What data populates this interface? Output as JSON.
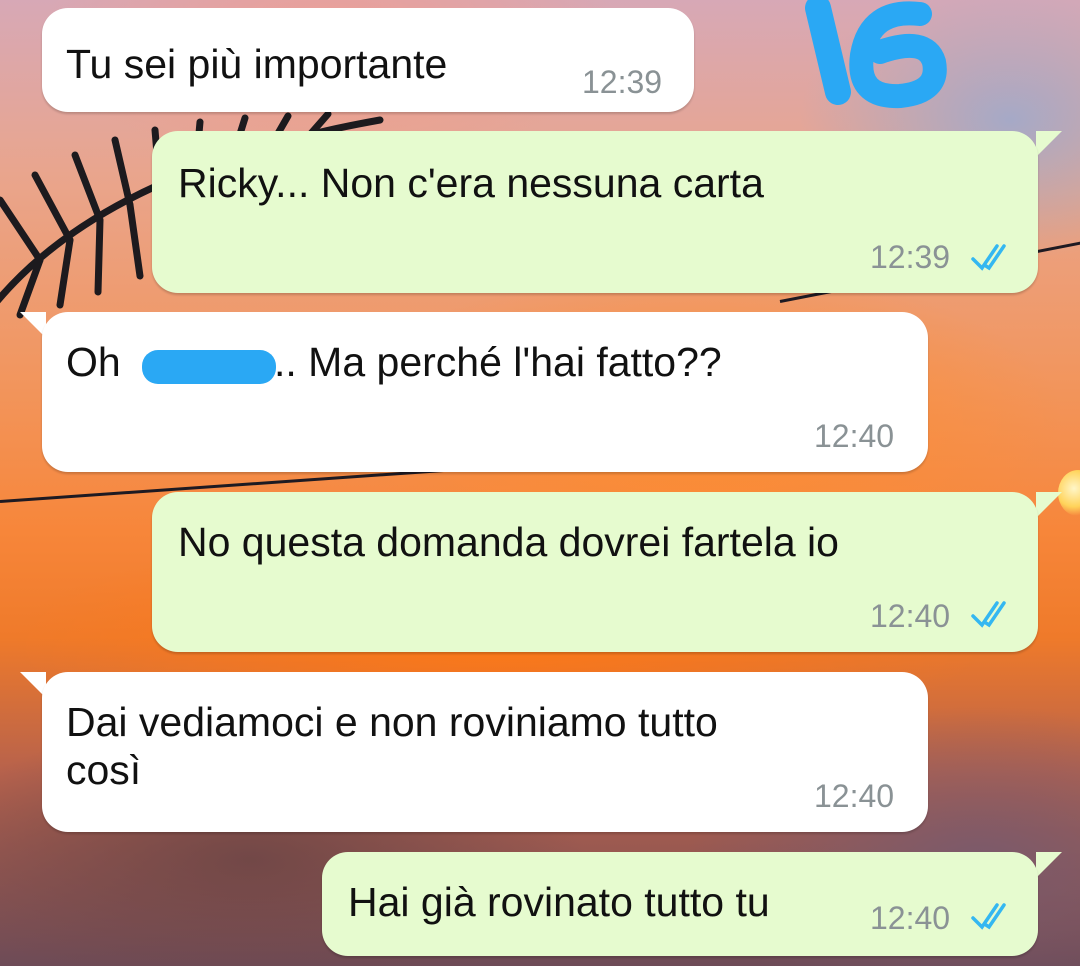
{
  "chat": {
    "messages": [
      {
        "direction": "incoming",
        "text": "Tu sei più importante",
        "time": "12:39"
      },
      {
        "direction": "outgoing",
        "text": "Ricky... Non c'era nessuna carta",
        "time": "12:39",
        "status": "read-double-check"
      },
      {
        "direction": "incoming",
        "text_prefix": "Oh",
        "text_suffix": ".. Ma perché l'hai fatto??",
        "redacted": true,
        "time": "12:40"
      },
      {
        "direction": "outgoing",
        "text": "No questa domanda dovrei fartela io",
        "time": "12:40",
        "status": "read-double-check"
      },
      {
        "direction": "incoming",
        "text": "Dai vediamoci e non roviniamo tutto\ncosì",
        "time": "12:40"
      },
      {
        "direction": "outgoing",
        "text": "Hai già rovinato tutto tu",
        "time": "12:40",
        "status": "read-double-check"
      }
    ]
  },
  "colors": {
    "incoming_bubble": "#ffffff",
    "outgoing_bubble": "#e6fbcf",
    "read_check": "#34b7f1",
    "timestamp": "#8a9295",
    "redaction": "#2aa8f4",
    "sticker": "#2aa8f4"
  },
  "icons": {
    "read_status": "double-check-icon",
    "sticker": "sticker-number-icon"
  }
}
